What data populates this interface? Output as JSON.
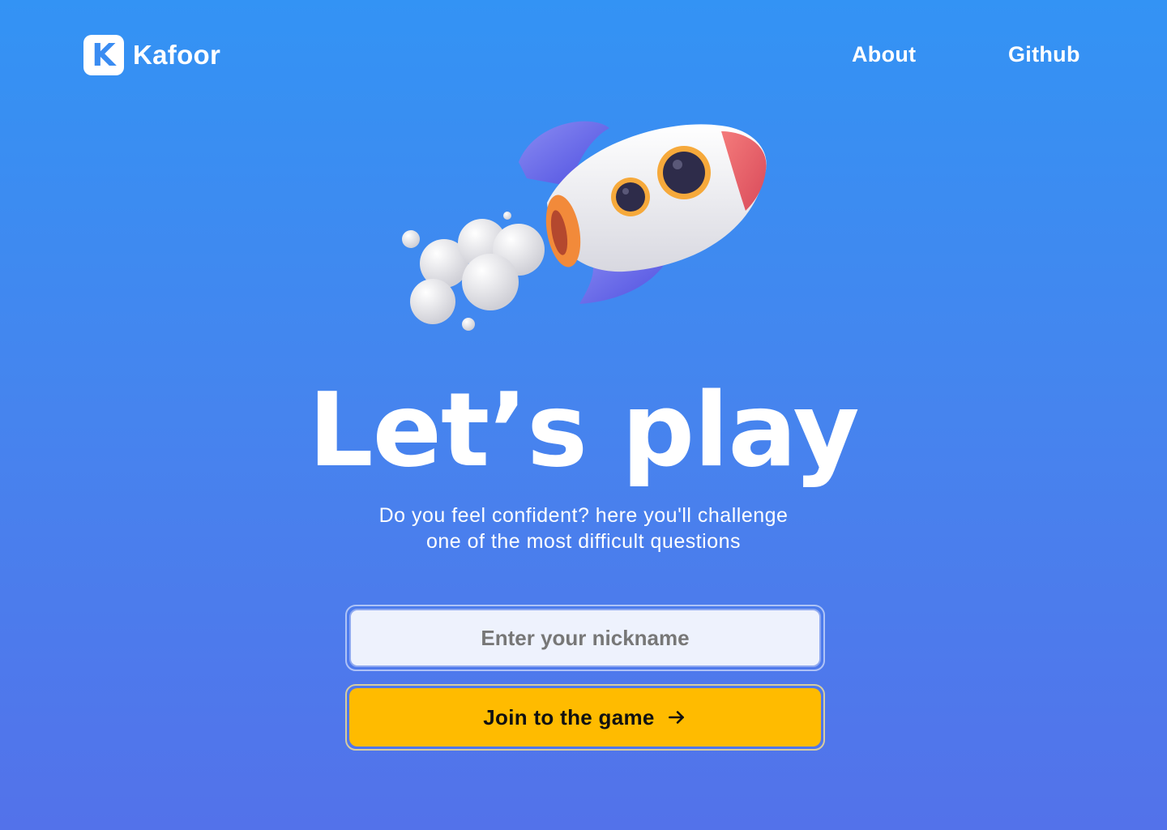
{
  "brand": {
    "name": "Kafoor",
    "mark": "K"
  },
  "nav": {
    "about": "About",
    "github": "Github"
  },
  "hero": {
    "illustration": "rocket-icon",
    "title": "Let’s play",
    "subtitle_line1": "Do you feel confident? here you'll challenge",
    "subtitle_line2": "one of the most difficult questions"
  },
  "form": {
    "nickname_placeholder": "Enter your nickname",
    "nickname_value": "",
    "join_label": "Join to the game",
    "join_icon": "arrow-right-icon"
  },
  "colors": {
    "background_top": "#3393F4",
    "background_bottom": "#5372EA",
    "button": "#FFBB00",
    "input": "#EEF2FD"
  }
}
